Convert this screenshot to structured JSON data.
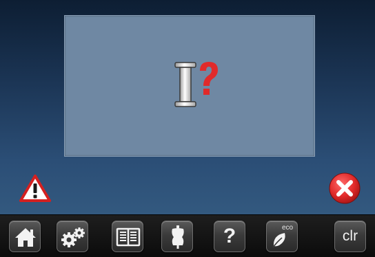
{
  "colors": {
    "panel": "#6f88a3",
    "background_top": "#0d1e33",
    "background_bottom": "#33597f",
    "accent_red": "#e12a2a",
    "toolbar_button": "#3b3b3b"
  },
  "dialog": {
    "icon": "thread-spool-question-icon"
  },
  "status": {
    "warning_icon": "warning-triangle-icon"
  },
  "actions": {
    "close_icon": "close-x-icon"
  },
  "toolbar": {
    "items": [
      {
        "icon": "home-icon"
      },
      {
        "icon": "settings-gears-icon"
      },
      {
        "icon": "tutorial-book-icon"
      },
      {
        "icon": "dress-form-icon"
      },
      {
        "icon": "help-icon",
        "label": "?"
      },
      {
        "icon": "eco-leaf-icon",
        "label": "eco"
      },
      {
        "icon": "clear-icon",
        "label": "clr"
      }
    ]
  }
}
